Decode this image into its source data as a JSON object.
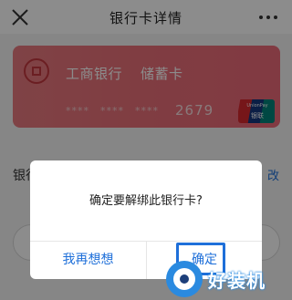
{
  "header": {
    "title": "银行卡详情",
    "close_icon": "close-icon",
    "more_icon": "more-dots-icon"
  },
  "card": {
    "bank_name": "工商银行",
    "card_type": "储蓄卡",
    "masked_groups": [
      "****",
      "****",
      "****"
    ],
    "last4": "2679",
    "network_logo_line1": "UnionPay",
    "network_logo_line2": "银联",
    "gradient_colors": [
      "#e87a80",
      "#ec6a79"
    ]
  },
  "background_row": {
    "left_text": "银行",
    "right_text": "改"
  },
  "dialog": {
    "message": "确定要解绑此银行卡?",
    "cancel_label": "我再想想",
    "confirm_label": "确定"
  },
  "watermark": {
    "text": "好装机"
  },
  "colors": {
    "accent": "#1e6fd9",
    "overlay": "rgba(0,0,0,0.45)"
  }
}
